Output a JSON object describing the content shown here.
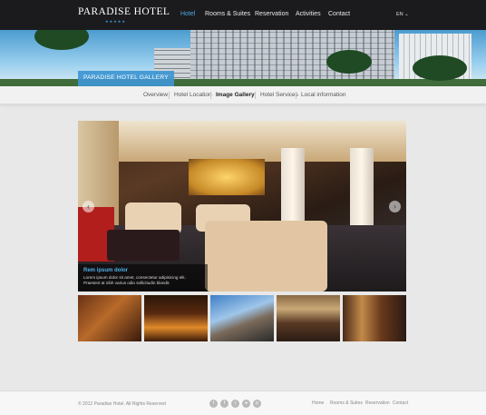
{
  "brand": {
    "name": "PARADISE HOTEL",
    "stars": "★★★★★"
  },
  "nav": {
    "items": [
      "Hotel",
      "Rooms & Suites",
      "Reservation",
      "Activities",
      "Contact"
    ],
    "active": "Hotel",
    "lang": "EN ⌄"
  },
  "banner": {
    "label": "PARADISE HOTEL GALLERY"
  },
  "subnav": {
    "items": [
      "Overview",
      "Hotel Location",
      "Image Gallery",
      "Hotel Services",
      "Local information"
    ],
    "active": "Image Gallery"
  },
  "slide": {
    "caption_title": "Rem ipsum dolor",
    "caption_line1": "Lorem ipsum dolor sit amet, consectetur adipisicing elit.",
    "caption_line2": "Praesent at nibh varius odio sollicitudin blandit.",
    "prev_arrow": "‹",
    "next_arrow": "›"
  },
  "footer": {
    "copyright": "© 2012 Paradise Hotel. All Rights Reserved",
    "social_icons": [
      "twitter-icon",
      "facebook-icon",
      "rss-icon",
      "flickr-icon",
      "pinterest-icon"
    ],
    "links": [
      "Home",
      "Rooms & Suites",
      "Reservation",
      "Contact"
    ]
  },
  "colors": {
    "accent": "#4aa9e3",
    "topbar": "#1b1b1d",
    "background": "#e8e8e8"
  }
}
